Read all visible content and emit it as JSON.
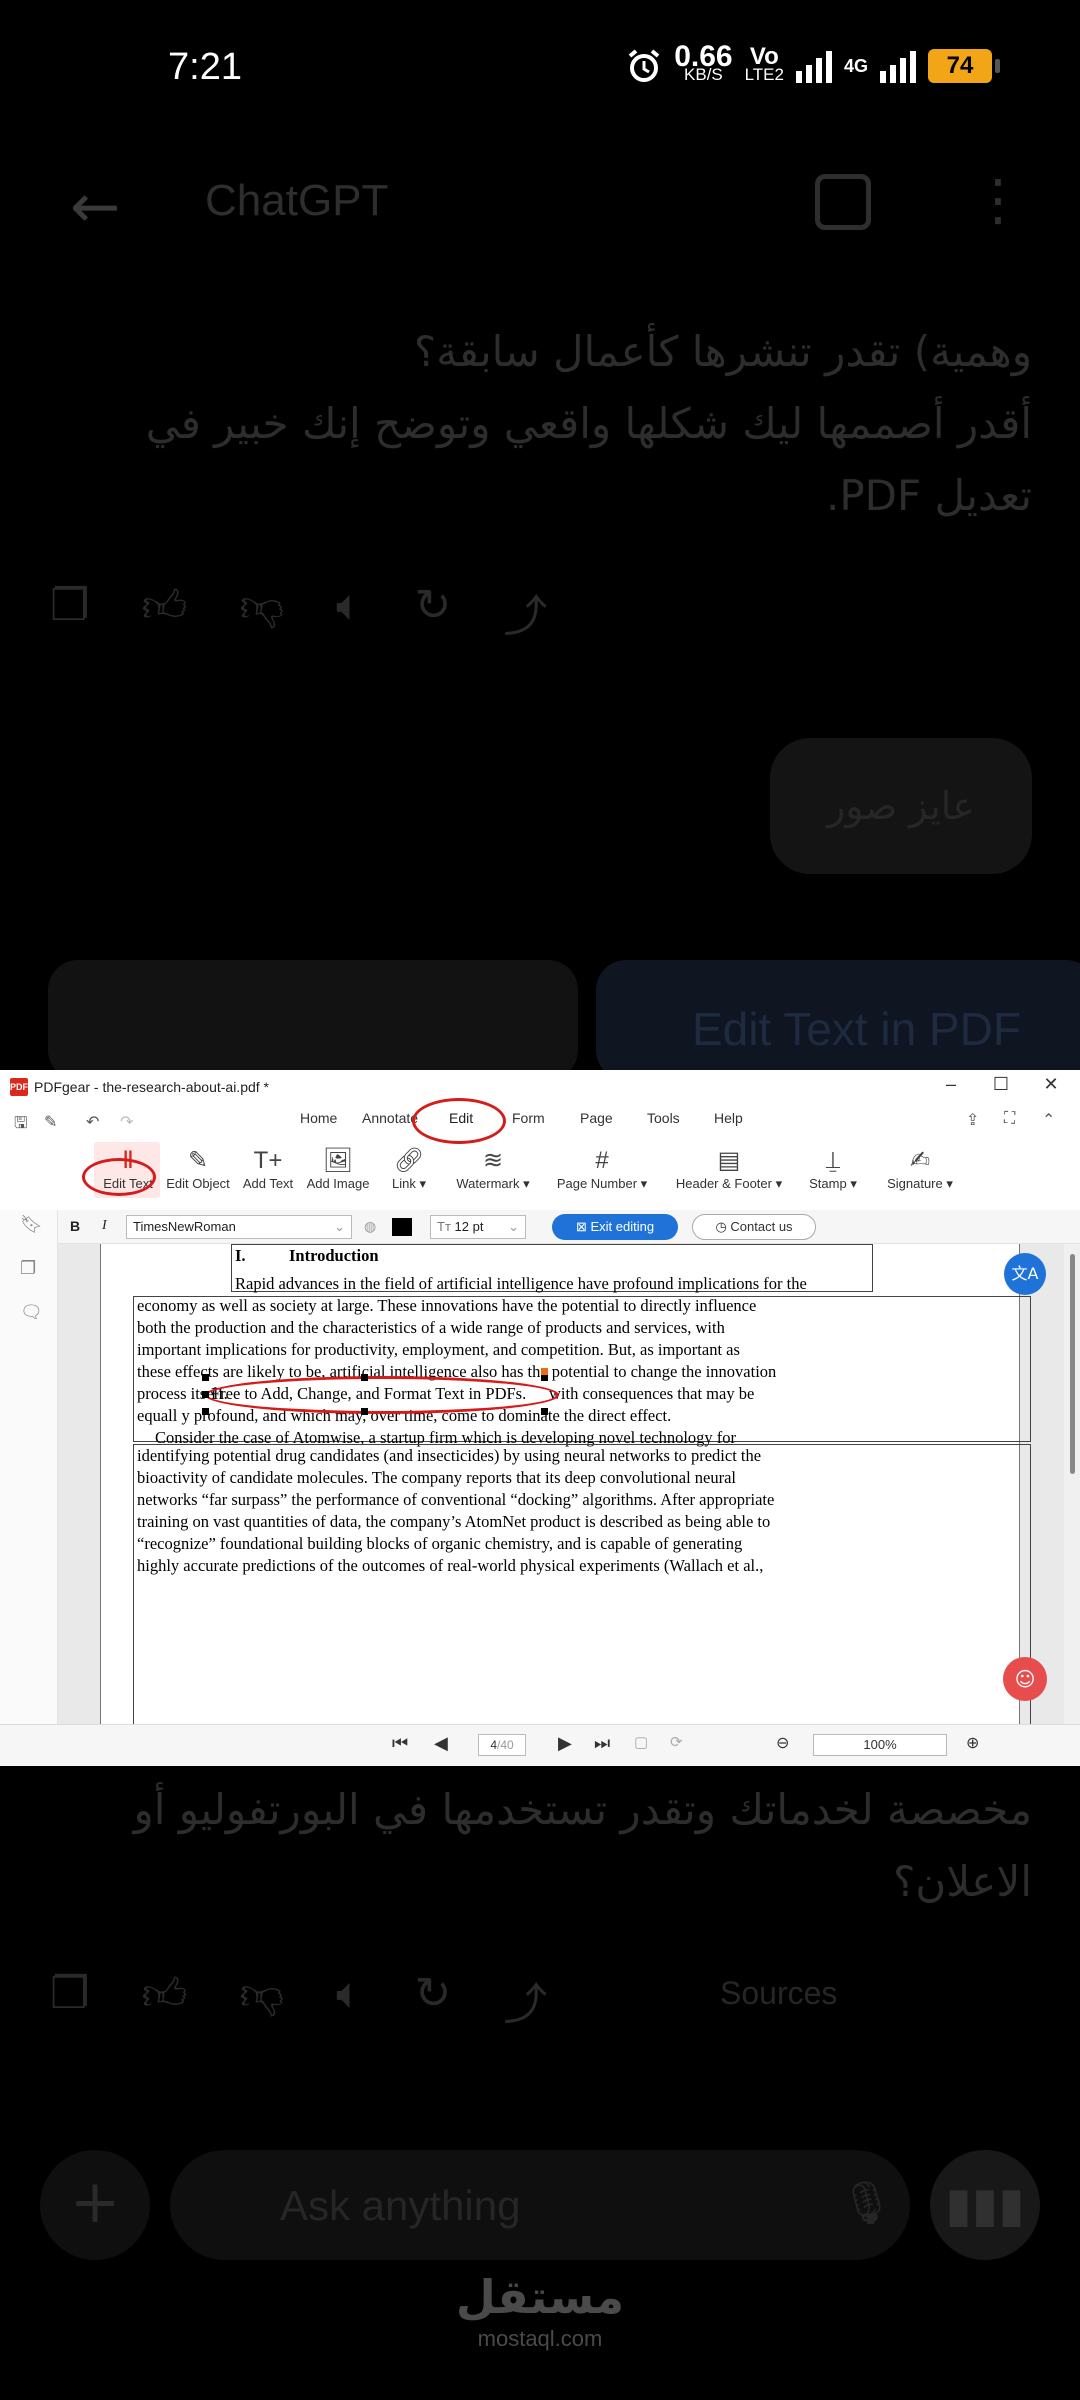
{
  "status_bar": {
    "time": "7:21",
    "net_speed_value": "0.66",
    "net_speed_unit": "KB/S",
    "volte_top": "Vo",
    "volte_bottom": "LTE2",
    "network": "4G",
    "battery": "74"
  },
  "chat": {
    "title": "ChatGPT",
    "msg_line1": "وهمية) تقدر تنشرها كأعمال سابقة؟",
    "msg_line2": "أقدر أصممها ليك شكلها واقعي وتوضح إنك خبير في",
    "msg_line3": "تعديل PDF.",
    "user_bubble": "عايز صور",
    "card_title": "Edit Text in PDF",
    "msg2_line1": "مخصصة لخدماتك وتقدر تستخدمها في البورتفوليو أو",
    "msg2_line2": "الاعلان؟",
    "sources_label": "Sources",
    "input_placeholder": "Ask anything"
  },
  "pdfgear": {
    "window_title": "PDFgear - the-research-about-ai.pdf *",
    "menus": [
      "Home",
      "Annotate",
      "Edit",
      "Form",
      "Page",
      "Tools",
      "Help"
    ],
    "ribbon": {
      "edit_text": "Edit Text",
      "edit_object": "Edit Object",
      "add_text": "Add Text",
      "add_image": "Add Image",
      "link": "Link",
      "watermark": "Watermark",
      "page_number": "Page Number",
      "header_footer": "Header & Footer",
      "stamp": "Stamp",
      "signature": "Signature"
    },
    "format": {
      "bold": "B",
      "italic": "I",
      "font": "TimesNewRoman",
      "size": "12 pt",
      "exit_editing": "Exit editing",
      "contact_us": "Contact us"
    },
    "document": {
      "heading_num": "I.",
      "heading": "Introduction",
      "lines": [
        "Rapid advances in the field of artificial intelligence have profound implications for the",
        "economy as well as society at large.  These innovations have the potential to directly influence",
        "both the production and the characteristics of a wide range of products and services, with",
        "important implications for productivity, employment, and competition. But, as important as",
        "these effects are likely to be, artificial intelligence also has the potential to change the innovation",
        "process itself.",
        "Free to Add, Change, and Format Text in PDFs.",
        "with consequences that may be",
        "equall y profound, and which may, over time, come to dominate the direct effect.",
        "Consider the case of Atomwise, a startup firm which is developing novel technology for",
        "identifying potential drug candidates (and insecticides) by using neural networks to predict the",
        "bioactivity of candidate molecules.  The company reports that its deep convolutional neural",
        "networks “far surpass” the performance of conventional “docking” algorithms.  After appropriate",
        "training on vast quantities of data, the company’s AtomNet product is described as being able to",
        "“recognize” foundational building blocks of organic chemistry, and is capable of generating",
        "highly accurate predictions of the outcomes of real-world physical experiments (Wallach et al.,"
      ]
    },
    "page_current": "4",
    "page_total": "/40",
    "zoom": "100%"
  },
  "watermark": {
    "arabic": "مستقل",
    "latin": "mostaql.com"
  }
}
